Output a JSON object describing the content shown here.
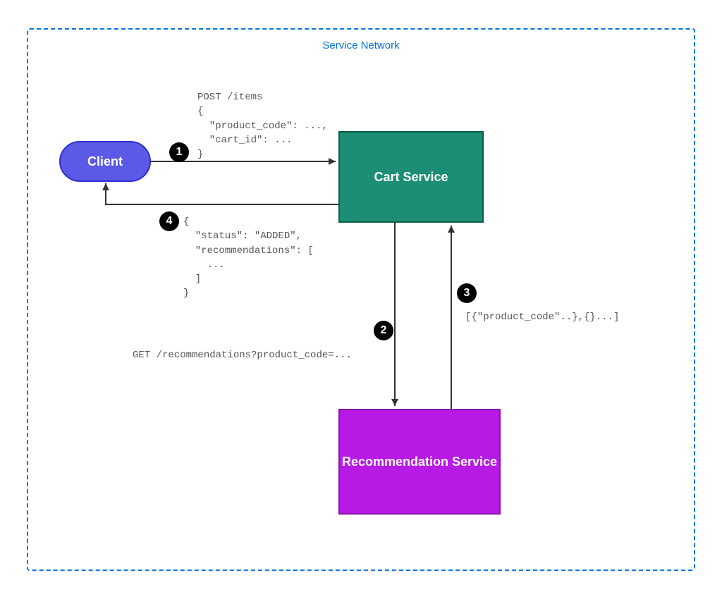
{
  "network": {
    "title": "Service Network"
  },
  "nodes": {
    "client": {
      "label": "Client"
    },
    "cart": {
      "label": "Cart\nService"
    },
    "reco": {
      "label": "Recommendation\nService"
    }
  },
  "steps": {
    "s1": {
      "num": "1",
      "payload": "POST /items\n{\n  \"product_code\": ...,\n  \"cart_id\": ...\n}"
    },
    "s2": {
      "num": "2",
      "payload": "GET /recommendations?product_code=..."
    },
    "s3": {
      "num": "3",
      "payload": "[{\"product_code\"..},{}...]"
    },
    "s4": {
      "num": "4",
      "payload": "{\n  \"status\": \"ADDED\",\n  \"recommendations\": [\n    ...\n  ]\n}"
    }
  },
  "colors": {
    "frame": "#0073e6",
    "client": "#5a5ae6",
    "cart": "#1d8e76",
    "reco": "#b81ae6"
  }
}
